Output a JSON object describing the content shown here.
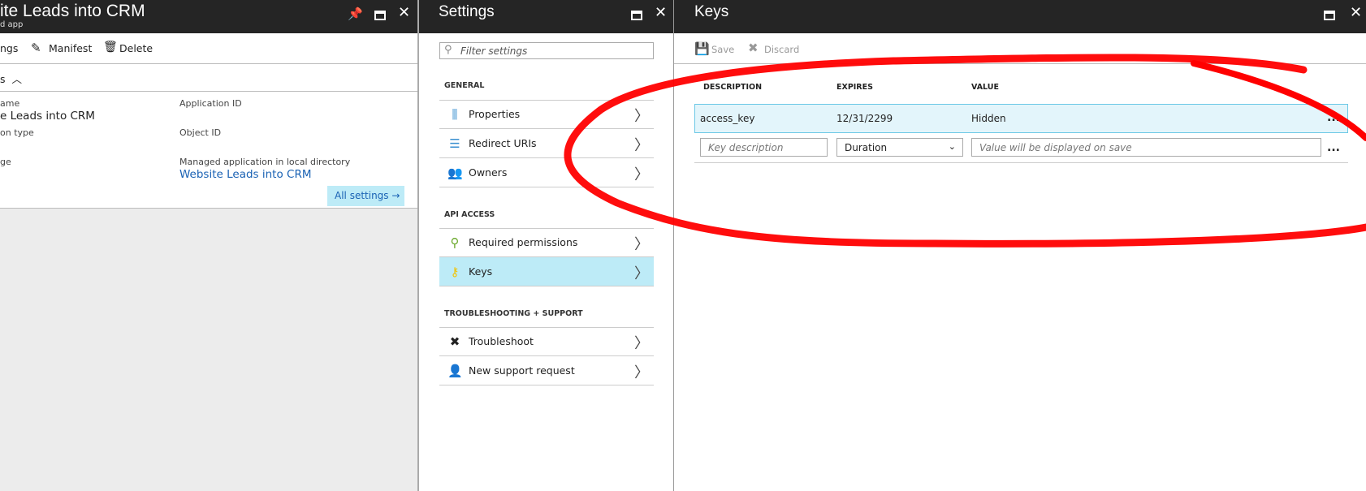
{
  "app_panel": {
    "title": "ite Leads into CRM",
    "subtitle": "d app",
    "toolbar": {
      "settings": "ngs",
      "manifest": "Manifest",
      "delete": "Delete"
    },
    "essentials": "s",
    "fields": {
      "name_label": "ame",
      "name_value": "e Leads into CRM",
      "app_type_label": "on type",
      "homepage_label": "ge",
      "app_id_label": "Application ID",
      "object_id_label": "Object ID",
      "managed_label": "Managed application in local directory",
      "managed_link": "Website Leads into CRM"
    },
    "all_settings": "All settings →"
  },
  "settings_panel": {
    "title": "Settings",
    "filter_placeholder": "Filter settings",
    "sections": [
      {
        "label": "GENERAL",
        "items": [
          "Properties",
          "Redirect URIs",
          "Owners"
        ]
      },
      {
        "label": "API ACCESS",
        "items": [
          "Required permissions",
          "Keys"
        ]
      },
      {
        "label": "TROUBLESHOOTING + SUPPORT",
        "items": [
          "Troubleshoot",
          "New support request"
        ]
      }
    ],
    "selected": "Keys"
  },
  "keys_panel": {
    "title": "Keys",
    "toolbar": {
      "save": "Save",
      "discard": "Discard"
    },
    "columns": [
      "DESCRIPTION",
      "EXPIRES",
      "VALUE"
    ],
    "rows": [
      {
        "description": "access_key",
        "expires": "12/31/2299",
        "value": "Hidden"
      }
    ],
    "new_row": {
      "description_placeholder": "Key description",
      "duration": "Duration",
      "value_placeholder": "Value will be displayed on save"
    },
    "more": "..."
  },
  "colors": {
    "header": "#252525",
    "selected": "#bdebf7",
    "link": "#1a62b4",
    "annotation": "#ff0000"
  }
}
